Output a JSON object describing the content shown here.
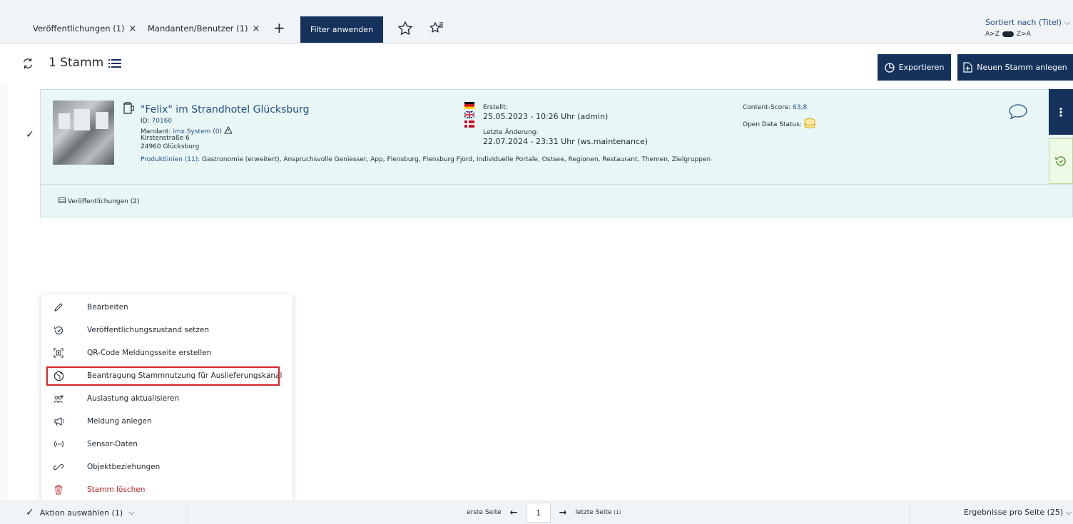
{
  "filter_bar": {
    "tabs": [
      {
        "label": "Veröffentlichungen (1)",
        "close": "×"
      },
      {
        "label": "Mandanten/Benutzer (1)",
        "close": "×"
      }
    ],
    "add_label": "+",
    "apply_label": "Filter anwenden",
    "icons": [
      "star-icon",
      "star-list-icon"
    ]
  },
  "sort": {
    "label": "Sortiert nach (Titel)",
    "asc_label": "A>Z",
    "desc_label": "Z>A"
  },
  "header": {
    "count_title": "1 Stamm",
    "export_label": "Exportieren",
    "new_label": "Neuen Stamm anlegen"
  },
  "record": {
    "title": "\"Felix\" im Strandhotel Glücksburg",
    "id_label": "ID:",
    "id_value": "70160",
    "client_label": "Mandant:",
    "client_value": "imx.System (0)",
    "street": "Kirstenstraße 6",
    "city": "24960 Glücksburg",
    "product_lines_label": "Produktlinien (11):",
    "product_lines_value": "Gastronomie (erweitert), Anspruchsvolle Geniesser, App, Flensburg, Flensburg Fjord, Individuelle Portale, Ostsee, Regionen, Restaurant, Themen, Zielgruppen",
    "created_label": "Erstellt:",
    "created_value": "25.05.2023 - 10:26 Uhr (admin)",
    "modified_label": "Letzte Änderung:",
    "modified_value": "22.07.2024 - 23:31 Uhr (ws.maintenance)",
    "content_score_label": "Content-Score:",
    "content_score_value": "63,8",
    "open_data_label": "Open Data Status:",
    "side_more_label": "⋮",
    "publications_link": "Veröffentlichungen (2)"
  },
  "context_menu": {
    "items": [
      {
        "label": "Bearbeiten",
        "icon": "pencil-icon"
      },
      {
        "label": "Veröffentlichungszustand setzen",
        "icon": "publish-state-icon"
      },
      {
        "label": "QR-Code Meldungsseite erstellen",
        "icon": "qr-code-icon"
      },
      {
        "label": "Beantragung Stammnutzung für Auslieferungskanal",
        "icon": "globe-request-icon"
      },
      {
        "label": "Auslastung aktualisieren",
        "icon": "occupancy-icon"
      },
      {
        "label": "Meldung anlegen",
        "icon": "megaphone-icon"
      },
      {
        "label": "Sensor-Daten",
        "icon": "sensor-icon"
      },
      {
        "label": "Objektbeziehungen",
        "icon": "link-icon"
      },
      {
        "label": "Stamm löschen",
        "icon": "trash-icon"
      }
    ]
  },
  "bottom_bar": {
    "action_label": "Aktion auswählen (1)",
    "first_page": "erste Seite",
    "current_page": "1",
    "last_page": "letzte Seite",
    "last_page_count": "(1)",
    "per_page": "Ergebnisse pro Seite (25)"
  },
  "colors": {
    "primary": "#14325c",
    "card_bg": "#e9f6f6",
    "highlight": "#d7262a",
    "link": "#1f4f86"
  }
}
